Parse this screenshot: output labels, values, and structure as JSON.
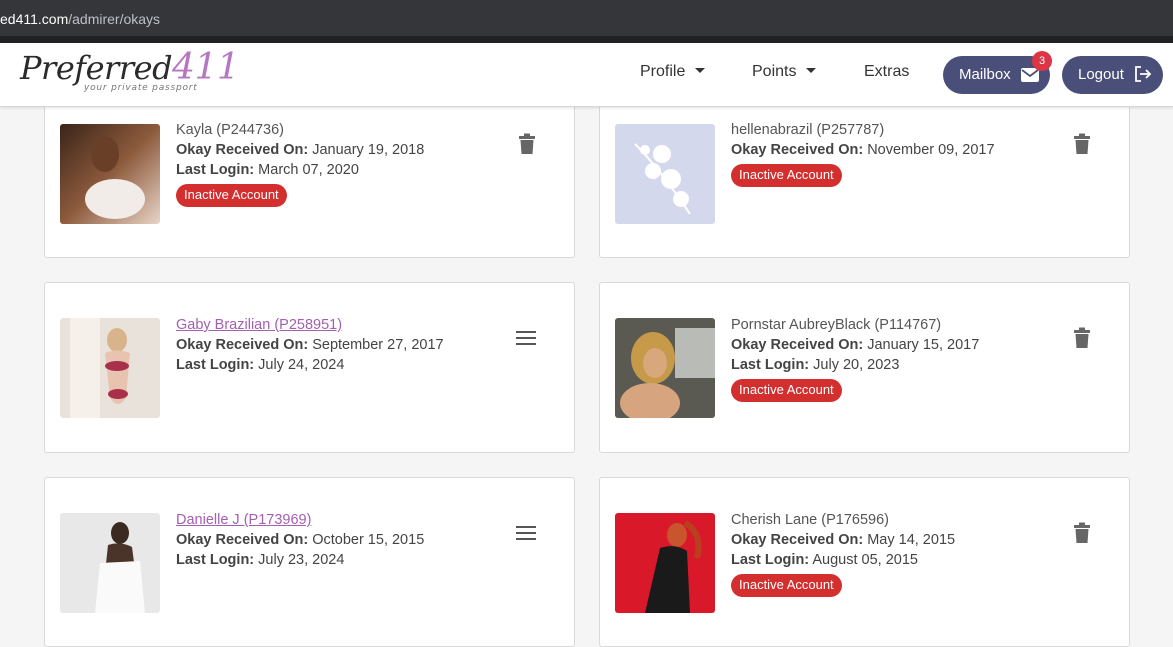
{
  "browser": {
    "url_host": "ed411.com",
    "url_path": "/admirer/okays"
  },
  "nav": {
    "logo_text": "Preferred",
    "logo_number": "411",
    "logo_tagline": "your private passport",
    "profile_label": "Profile",
    "points_label": "Points",
    "extras_label": "Extras",
    "mailbox_label": "Mailbox",
    "mailbox_count": "3",
    "logout_label": "Logout"
  },
  "labels": {
    "okay_received": "Okay Received On:",
    "last_login": "Last Login:"
  },
  "cards": [
    {
      "name": "Kayla (P244736)",
      "name_style": "plain",
      "okay_date": "January 19, 2018",
      "last_login": "March 07, 2020",
      "status": "Inactive Account",
      "action": "trash-icon"
    },
    {
      "name": "hellenabrazil (P257787)",
      "name_style": "plain",
      "okay_date": "November 09, 2017",
      "last_login": "",
      "status": "Inactive Account",
      "action": "trash-icon"
    },
    {
      "name": "Gaby Brazilian (P258951)",
      "name_style": "link",
      "okay_date": "September 27, 2017",
      "last_login": "July 24, 2024",
      "status": "",
      "action": "menu-icon"
    },
    {
      "name": "Pornstar AubreyBlack (P114767)",
      "name_style": "plain",
      "okay_date": "January 15, 2017",
      "last_login": "July 20, 2023",
      "status": "Inactive Account",
      "action": "trash-icon"
    },
    {
      "name": "Danielle J (P173969)",
      "name_style": "link",
      "okay_date": "October 15, 2015",
      "last_login": "July 23, 2024",
      "status": "",
      "action": "menu-icon"
    },
    {
      "name": "Cherish Lane (P176596)",
      "name_style": "plain",
      "okay_date": "May 14, 2015",
      "last_login": "August 05, 2015",
      "status": "Inactive Account",
      "action": "trash-icon"
    }
  ],
  "colors": {
    "accent": "#4a4f7a",
    "link": "#a35fb0",
    "inactive": "#d32f2f"
  }
}
